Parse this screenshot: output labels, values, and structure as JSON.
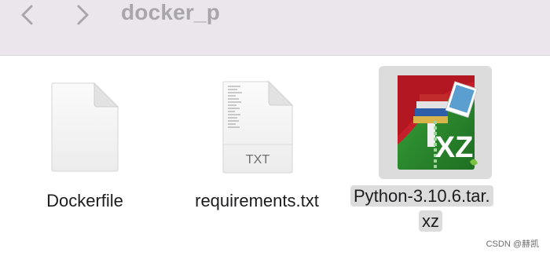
{
  "window": {
    "title": "docker_p",
    "back_icon": "chevron-left-icon",
    "forward_icon": "chevron-right-icon"
  },
  "files": [
    {
      "name": "Dockerfile",
      "icon": "generic-document-icon",
      "selected": false
    },
    {
      "name": "requirements.txt",
      "icon": "text-document-icon",
      "badge": "TXT",
      "selected": false
    },
    {
      "name_line1": "Python-3.10.6.tar.",
      "name_line2": "xz",
      "icon": "xz-archive-icon",
      "badge": "XZ",
      "selected": true
    }
  ],
  "watermark": "CSDN @赫凯",
  "colors": {
    "toolbar_bg": "#ebe6ec",
    "selection_bg": "#dcdcdc",
    "archive_green": "#2e8b2e",
    "archive_red": "#c41f2a"
  }
}
